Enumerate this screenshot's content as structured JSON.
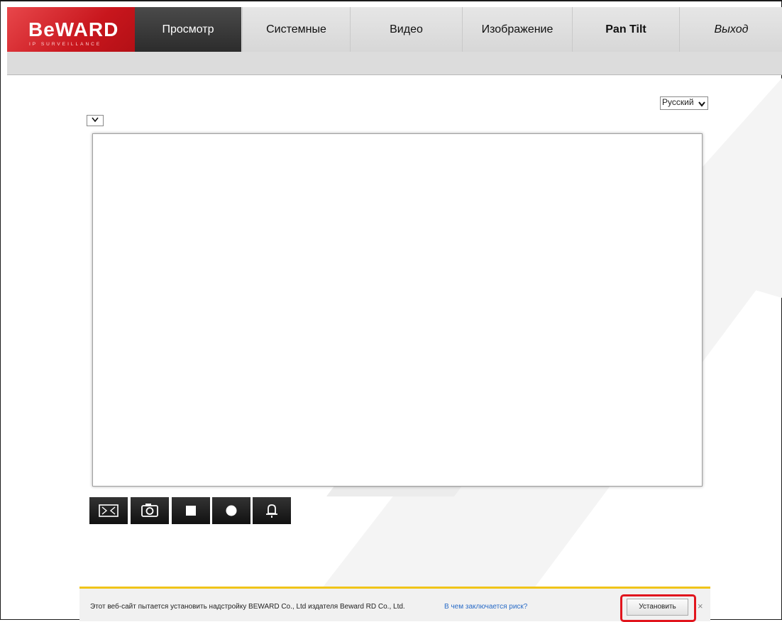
{
  "logo": {
    "text": "BeWARD",
    "subtitle": "IP SURVEILLANCE"
  },
  "nav": {
    "items": [
      {
        "label": "Просмотр"
      },
      {
        "label": "Системные"
      },
      {
        "label": "Видео"
      },
      {
        "label": "Изображение"
      },
      {
        "label": "Pan Tilt"
      },
      {
        "label": "Выход"
      }
    ],
    "active_index": 0
  },
  "language": {
    "selected": "Русский"
  },
  "stream_select": {
    "selected": ""
  },
  "controls": [
    {
      "icon": "fullscreen-icon"
    },
    {
      "icon": "snapshot-icon"
    },
    {
      "icon": "stop-icon"
    },
    {
      "icon": "record-icon"
    },
    {
      "icon": "alarm-icon"
    }
  ],
  "infobar": {
    "message": "Этот веб-сайт пытается установить надстройку BEWARD Co., Ltd издателя Beward RD Co., Ltd.",
    "link": "В чем заключается риск?",
    "install_label": "Установить",
    "close_label": "×"
  },
  "colors": {
    "brand": "#c8161d",
    "nav_active": "#3a3a3a",
    "info_accent": "#f0c419",
    "highlight": "#e1151d",
    "link": "#2a6cc7"
  }
}
